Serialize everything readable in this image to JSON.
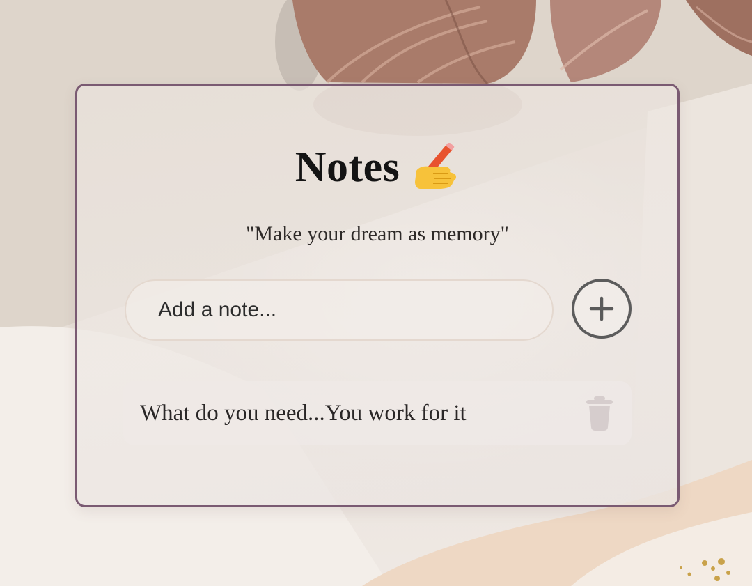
{
  "colors": {
    "card_border": "#7a5a72",
    "title": "#141414",
    "add_button_border": "#5c5c5c",
    "trash_icon": "#d6cdcd"
  },
  "header": {
    "title": "Notes",
    "title_icon": "writing-hand-icon",
    "subtitle": "\"Make your dream as memory\""
  },
  "input": {
    "placeholder": "Add a note...",
    "value": ""
  },
  "add_button": {
    "icon": "plus-icon"
  },
  "notes": [
    {
      "text": "What do you need...You work for it",
      "delete_icon": "trash-icon"
    }
  ]
}
